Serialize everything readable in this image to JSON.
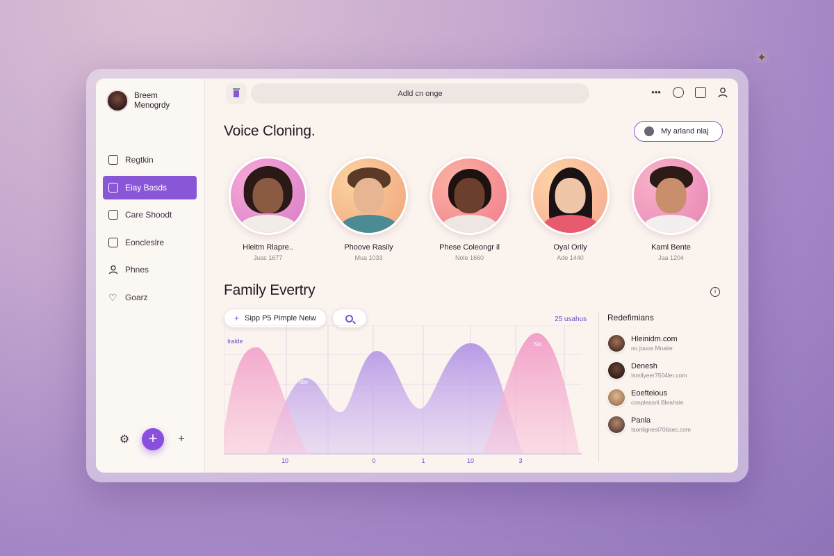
{
  "profile": {
    "name": "Breem Menogrdy"
  },
  "sidebar": {
    "items": [
      {
        "label": "Regtkin",
        "icon": "calendar-icon",
        "active": false
      },
      {
        "label": "Eiay Basds",
        "icon": "grid-icon",
        "active": true
      },
      {
        "label": "Care Shoodt",
        "icon": "image-icon",
        "active": false
      },
      {
        "label": "Eoncleslre",
        "icon": "card-icon",
        "active": false
      },
      {
        "label": "Phnes",
        "icon": "user-icon",
        "active": false
      },
      {
        "label": "Goarz",
        "icon": "heart-icon",
        "active": false
      }
    ],
    "bottom_icons": [
      "settings-icon",
      "add-icon",
      "plus-icon"
    ]
  },
  "topbar": {
    "search_text": "Adld cn onge",
    "icons": [
      "more-icon",
      "emoji-icon",
      "mobile-icon",
      "account-icon"
    ]
  },
  "voice_section": {
    "title": "Voice Cloning.",
    "action_button": "My arland nlaj",
    "voices": [
      {
        "name": "Hleitm Rlapre..",
        "sub": "Juas 1677"
      },
      {
        "name": "Phoove Rasily",
        "sub": "Mua 1033"
      },
      {
        "name": "Phese Coleongr il",
        "sub": "Nole 1660"
      },
      {
        "name": "Oyal Orily",
        "sub": "Ade 1440"
      },
      {
        "name": "Kaml Bente",
        "sub": "Jaa 1204"
      }
    ]
  },
  "family_section": {
    "title": "Family Evertry",
    "filter_button": "Sipp P5 Pimple Neiw",
    "note": "25 usahus"
  },
  "chart_data": {
    "type": "area",
    "series_label": "Iralde",
    "x_ticks": [
      "10",
      "0",
      "1",
      "10",
      "3"
    ],
    "peak_labels": [
      "obs",
      "Slo"
    ],
    "series": [
      {
        "name": "",
        "color": "#f29bc6",
        "peaks": [
          0.83,
          0.94
        ]
      },
      {
        "name": "",
        "color": "#b79ae6",
        "peaks": [
          0.59,
          0.8,
          0.86
        ]
      }
    ],
    "grid": true
  },
  "definitions": {
    "title": "Redefimians",
    "items": [
      {
        "name": "Hleinidm.com",
        "sub": "no jouos Mnaler"
      },
      {
        "name": "Denesh",
        "sub": "Ismilyeer7504ler.com"
      },
      {
        "name": "Eoefteious",
        "sub": "conpleasrli Bleahsle"
      },
      {
        "name": "Panla",
        "sub": "Isonlignesl706sec.com"
      }
    ]
  },
  "colors": {
    "accent": "#8a56d8",
    "pink": "#f29bc6",
    "lavender": "#b79ae6",
    "window_bg": "#fbf4ee"
  }
}
